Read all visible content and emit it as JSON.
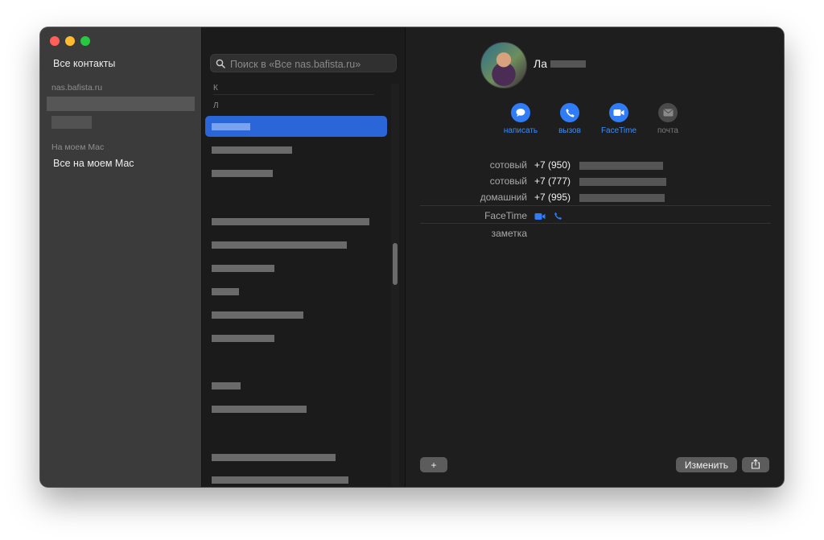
{
  "window": {
    "colors": {
      "accent": "#2f7cf6",
      "selection": "#2b66d9",
      "sidebar_bg": "#3b3b3b",
      "detail_bg": "#1e1e1e"
    }
  },
  "sidebar": {
    "all_contacts": "Все контакты",
    "account_section": "nas.bafista.ru",
    "local_section": "На моем Mac",
    "all_on_mac": "Все на моем Mac"
  },
  "list": {
    "search_placeholder": "Поиск в «Все nas.bafista.ru»",
    "letters": [
      "К",
      "Л"
    ]
  },
  "contact": {
    "name": "Ла",
    "actions": [
      {
        "label": "написать",
        "icon": "message-icon",
        "enabled": true
      },
      {
        "label": "вызов",
        "icon": "phone-icon",
        "enabled": true
      },
      {
        "label": "FaceTime",
        "icon": "video-icon",
        "enabled": true
      },
      {
        "label": "почта",
        "icon": "mail-icon",
        "enabled": false
      }
    ],
    "fields": [
      {
        "label": "сотовый",
        "value": "+7 (950)"
      },
      {
        "label": "сотовый",
        "value": "+7 (777)"
      },
      {
        "label": "домашний",
        "value": "+7 (995)"
      }
    ],
    "facetime_label": "FaceTime",
    "note_label": "заметка"
  },
  "footer": {
    "add_label": "+",
    "edit_label": "Изменить"
  }
}
